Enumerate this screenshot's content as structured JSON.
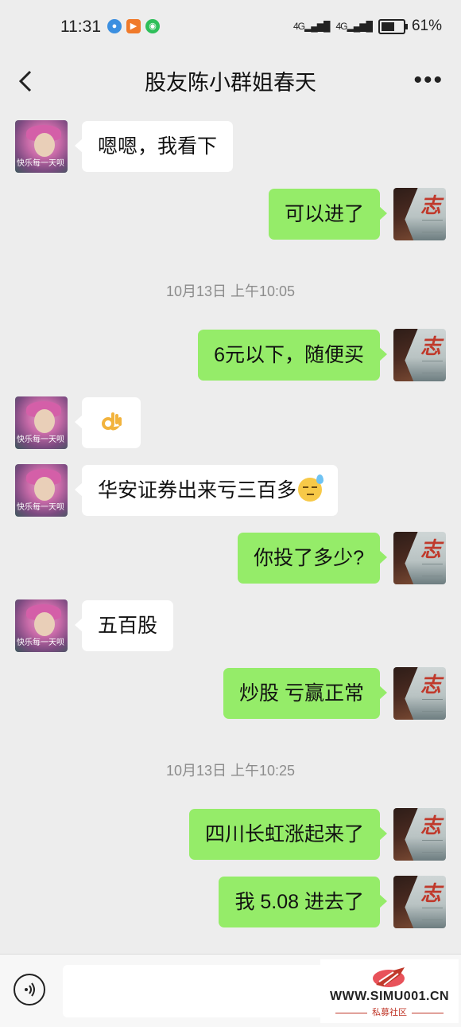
{
  "status_bar": {
    "time": "11:31",
    "network_1": "4G",
    "network_2": "4G",
    "battery_percent": 61,
    "battery_label": "61%",
    "app_icons": [
      "browser-icon",
      "video-icon",
      "wechat-icon"
    ]
  },
  "nav": {
    "title": "股友陈小群姐春天"
  },
  "chat": {
    "friend_avatar_text": "快乐每一天呗",
    "messages": [
      {
        "side": "left",
        "text": "嗯嗯，我看下"
      },
      {
        "side": "right",
        "text": "可以进了"
      },
      {
        "type": "timestamp",
        "text": "10月13日 上午10:05"
      },
      {
        "side": "right",
        "text": "6元以下，随便买"
      },
      {
        "side": "left",
        "emoji": "ok-hand-emoji"
      },
      {
        "side": "left",
        "text": "华安证券出来亏三百多",
        "emoji": "sweat-face-emoji"
      },
      {
        "side": "right",
        "text": "你投了多少?"
      },
      {
        "side": "left",
        "text": "五百股"
      },
      {
        "side": "right",
        "text": "炒股 亏赢正常"
      },
      {
        "type": "timestamp",
        "text": "10月13日 上午10:25"
      },
      {
        "side": "right",
        "text": "四川长虹涨起来了"
      },
      {
        "side": "right",
        "text": "我 5.08 进去了"
      }
    ]
  },
  "input_bar": {
    "watermark_text": "WWW.SIMU001.CN",
    "watermark_sub": "私募社区"
  },
  "colors": {
    "background": "#ededed",
    "bubble_me": "#95ec69",
    "bubble_friend": "#ffffff",
    "timestamp": "#8c8c8c"
  }
}
